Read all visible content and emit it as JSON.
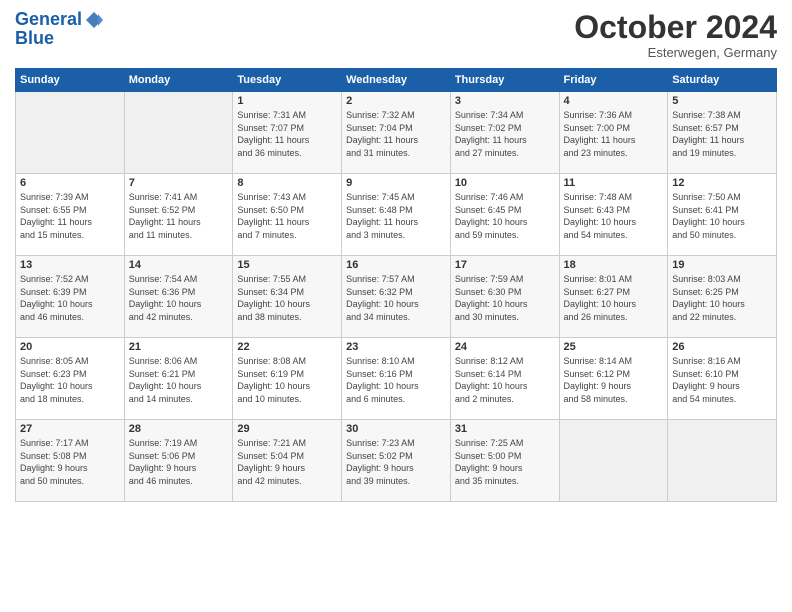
{
  "header": {
    "logo_line1": "General",
    "logo_line2": "Blue",
    "month": "October 2024",
    "location": "Esterwegen, Germany"
  },
  "days_of_week": [
    "Sunday",
    "Monday",
    "Tuesday",
    "Wednesday",
    "Thursday",
    "Friday",
    "Saturday"
  ],
  "weeks": [
    [
      {
        "day": "",
        "info": ""
      },
      {
        "day": "",
        "info": ""
      },
      {
        "day": "1",
        "info": "Sunrise: 7:31 AM\nSunset: 7:07 PM\nDaylight: 11 hours\nand 36 minutes."
      },
      {
        "day": "2",
        "info": "Sunrise: 7:32 AM\nSunset: 7:04 PM\nDaylight: 11 hours\nand 31 minutes."
      },
      {
        "day": "3",
        "info": "Sunrise: 7:34 AM\nSunset: 7:02 PM\nDaylight: 11 hours\nand 27 minutes."
      },
      {
        "day": "4",
        "info": "Sunrise: 7:36 AM\nSunset: 7:00 PM\nDaylight: 11 hours\nand 23 minutes."
      },
      {
        "day": "5",
        "info": "Sunrise: 7:38 AM\nSunset: 6:57 PM\nDaylight: 11 hours\nand 19 minutes."
      }
    ],
    [
      {
        "day": "6",
        "info": "Sunrise: 7:39 AM\nSunset: 6:55 PM\nDaylight: 11 hours\nand 15 minutes."
      },
      {
        "day": "7",
        "info": "Sunrise: 7:41 AM\nSunset: 6:52 PM\nDaylight: 11 hours\nand 11 minutes."
      },
      {
        "day": "8",
        "info": "Sunrise: 7:43 AM\nSunset: 6:50 PM\nDaylight: 11 hours\nand 7 minutes."
      },
      {
        "day": "9",
        "info": "Sunrise: 7:45 AM\nSunset: 6:48 PM\nDaylight: 11 hours\nand 3 minutes."
      },
      {
        "day": "10",
        "info": "Sunrise: 7:46 AM\nSunset: 6:45 PM\nDaylight: 10 hours\nand 59 minutes."
      },
      {
        "day": "11",
        "info": "Sunrise: 7:48 AM\nSunset: 6:43 PM\nDaylight: 10 hours\nand 54 minutes."
      },
      {
        "day": "12",
        "info": "Sunrise: 7:50 AM\nSunset: 6:41 PM\nDaylight: 10 hours\nand 50 minutes."
      }
    ],
    [
      {
        "day": "13",
        "info": "Sunrise: 7:52 AM\nSunset: 6:39 PM\nDaylight: 10 hours\nand 46 minutes."
      },
      {
        "day": "14",
        "info": "Sunrise: 7:54 AM\nSunset: 6:36 PM\nDaylight: 10 hours\nand 42 minutes."
      },
      {
        "day": "15",
        "info": "Sunrise: 7:55 AM\nSunset: 6:34 PM\nDaylight: 10 hours\nand 38 minutes."
      },
      {
        "day": "16",
        "info": "Sunrise: 7:57 AM\nSunset: 6:32 PM\nDaylight: 10 hours\nand 34 minutes."
      },
      {
        "day": "17",
        "info": "Sunrise: 7:59 AM\nSunset: 6:30 PM\nDaylight: 10 hours\nand 30 minutes."
      },
      {
        "day": "18",
        "info": "Sunrise: 8:01 AM\nSunset: 6:27 PM\nDaylight: 10 hours\nand 26 minutes."
      },
      {
        "day": "19",
        "info": "Sunrise: 8:03 AM\nSunset: 6:25 PM\nDaylight: 10 hours\nand 22 minutes."
      }
    ],
    [
      {
        "day": "20",
        "info": "Sunrise: 8:05 AM\nSunset: 6:23 PM\nDaylight: 10 hours\nand 18 minutes."
      },
      {
        "day": "21",
        "info": "Sunrise: 8:06 AM\nSunset: 6:21 PM\nDaylight: 10 hours\nand 14 minutes."
      },
      {
        "day": "22",
        "info": "Sunrise: 8:08 AM\nSunset: 6:19 PM\nDaylight: 10 hours\nand 10 minutes."
      },
      {
        "day": "23",
        "info": "Sunrise: 8:10 AM\nSunset: 6:16 PM\nDaylight: 10 hours\nand 6 minutes."
      },
      {
        "day": "24",
        "info": "Sunrise: 8:12 AM\nSunset: 6:14 PM\nDaylight: 10 hours\nand 2 minutes."
      },
      {
        "day": "25",
        "info": "Sunrise: 8:14 AM\nSunset: 6:12 PM\nDaylight: 9 hours\nand 58 minutes."
      },
      {
        "day": "26",
        "info": "Sunrise: 8:16 AM\nSunset: 6:10 PM\nDaylight: 9 hours\nand 54 minutes."
      }
    ],
    [
      {
        "day": "27",
        "info": "Sunrise: 7:17 AM\nSunset: 5:08 PM\nDaylight: 9 hours\nand 50 minutes."
      },
      {
        "day": "28",
        "info": "Sunrise: 7:19 AM\nSunset: 5:06 PM\nDaylight: 9 hours\nand 46 minutes."
      },
      {
        "day": "29",
        "info": "Sunrise: 7:21 AM\nSunset: 5:04 PM\nDaylight: 9 hours\nand 42 minutes."
      },
      {
        "day": "30",
        "info": "Sunrise: 7:23 AM\nSunset: 5:02 PM\nDaylight: 9 hours\nand 39 minutes."
      },
      {
        "day": "31",
        "info": "Sunrise: 7:25 AM\nSunset: 5:00 PM\nDaylight: 9 hours\nand 35 minutes."
      },
      {
        "day": "",
        "info": ""
      },
      {
        "day": "",
        "info": ""
      }
    ]
  ]
}
